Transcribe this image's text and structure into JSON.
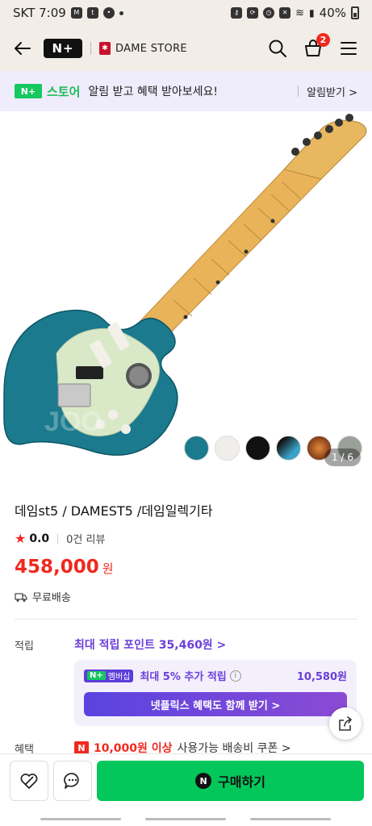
{
  "status": {
    "carrier_time": "SKT 7:09",
    "battery": "40%"
  },
  "header": {
    "nplus_logo": "N+",
    "store_name": "DAME STORE",
    "cart_count": "2"
  },
  "promo": {
    "nplus": "N+",
    "store": "스토어",
    "message": "알림 받고 혜택 받아보세요!",
    "action": "알림받기 >"
  },
  "gallery": {
    "counter": "1 / 6",
    "swatch_colors": [
      "#1b7a8e",
      "#f0eeea",
      "#111111",
      "#3aa3c9",
      "#c45a1f",
      "#9a9f98"
    ],
    "body_color": "#1b7a8e",
    "watermark": "JOO"
  },
  "product": {
    "title": "데임st5 / DAMEST5 /데임일렉기타",
    "rating": "0.0",
    "reviews": "0건 리뷰",
    "price": "458,000",
    "currency": "원",
    "shipping": "무료배송"
  },
  "points": {
    "label": "적립",
    "max": "최대 적립 포인트 35,460원 >",
    "member_badge": "멤버십",
    "member_plus": "N+",
    "extra": "최대 5% 추가 적립",
    "extra_value": "10,580원",
    "netflix": "넷플릭스 혜택도 함께 받기 >"
  },
  "benefit": {
    "label": "혜택",
    "icon": "N",
    "highlight": "10,000원 이상",
    "text": "사용가능 배송비 쿠폰 >"
  },
  "bottom": {
    "buy_label": "구매하기",
    "buy_icon": "N"
  }
}
